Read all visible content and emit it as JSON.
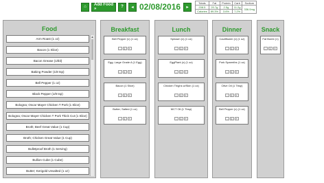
{
  "topbar": {
    "home_label": "⌂",
    "add_food_label": "Add Food »",
    "help_label": "?",
    "prev_label": "◂",
    "date": "02/08/2016",
    "next_label": "▸"
  },
  "stats": {
    "headers": [
      "Totals",
      "Fat",
      "Protein",
      "Carb",
      "Sodium"
    ],
    "row1": [
      "208.5",
      "20.7g",
      "2.5g",
      "11.2g",
      "336.0mg"
    ],
    "row2": [
      "Calories",
      "89.3%",
      "3.6%",
      "7.2%",
      ""
    ]
  },
  "food_panel": {
    "title": "Food",
    "items": [
      "Arm Roast (1 oz)",
      "Bacon (1 Slice)",
      "Bacon Grease (1/tbl)",
      "Baking Powder (1/8 tsp)",
      "Bell Pepper (1 oz)",
      "Black Pepper (1/8 tsp)",
      "Bologna; Oscar Mayer Chicken T Pork (1 Slice)",
      "Bologna; Oscar Mayer Chicken T Pork Thick Cut (1 Slice)",
      "Broth; Beef Great Value (1 Cup)",
      "Broth; Chicken Great Value (1 Cup)",
      "Bulletproof Broth (1 Serving)",
      "Bullion Cube (1 Cube)",
      "Butter; Kerigold Unsalted (1 oz)",
      "Butter; Salted (1 oz)"
    ]
  },
  "meals": [
    {
      "title": "Breakfast",
      "items": [
        "Bell Pepper (v) (1 oz)",
        "Egg; Large Grade A (1 Egg)",
        "Bacon (1 Slice)",
        "Butter; Salted (1 oz)"
      ]
    },
    {
      "title": "Lunch",
      "items": [
        "Spinach (v) (1 oz)",
        "EggPlant (v) (1 oz)",
        "Chicken Thighs w/Skin (1 oz)",
        "MCT Oil (1 Tbsp)"
      ]
    },
    {
      "title": "Dinner",
      "items": [
        "Cauliflower (v) (1 oz)",
        "Pork Spareribs (1 oz)",
        "Olive Oil (1 Tbsp)",
        "Bell Pepper (v) (1 oz)"
      ]
    },
    {
      "title": "Snack",
      "items": [
        "Fat Bomb (1)"
      ]
    }
  ],
  "qty_controls": {
    "minus": "-",
    "value": "1",
    "plus": "+"
  }
}
